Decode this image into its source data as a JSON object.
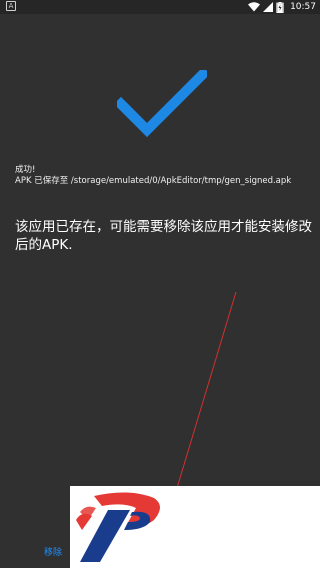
{
  "status_bar": {
    "left_icon": "app-a-icon",
    "left_glyph": "A",
    "time": "10:57",
    "battery_icon": "battery-charging-icon",
    "wifi_icon": "wifi-icon",
    "signal_icon": "cell-signal-icon"
  },
  "result": {
    "icon": "checkmark-icon",
    "icon_color": "#1e88e5",
    "success_text": "成功!",
    "path_text": "APK 已保存至 /storage/emulated/0/ApkEditor/tmp/gen_signed.apk",
    "message": "该应用已存在，可能需要移除该应用才能安装修改后的APK."
  },
  "actions": {
    "remove_label": "移除",
    "accent_color": "#1e90ff"
  },
  "overlay": {
    "logo_icon": "brand-p-logo-icon",
    "logo_colors": [
      "#e53935",
      "#1a3c8c"
    ]
  }
}
